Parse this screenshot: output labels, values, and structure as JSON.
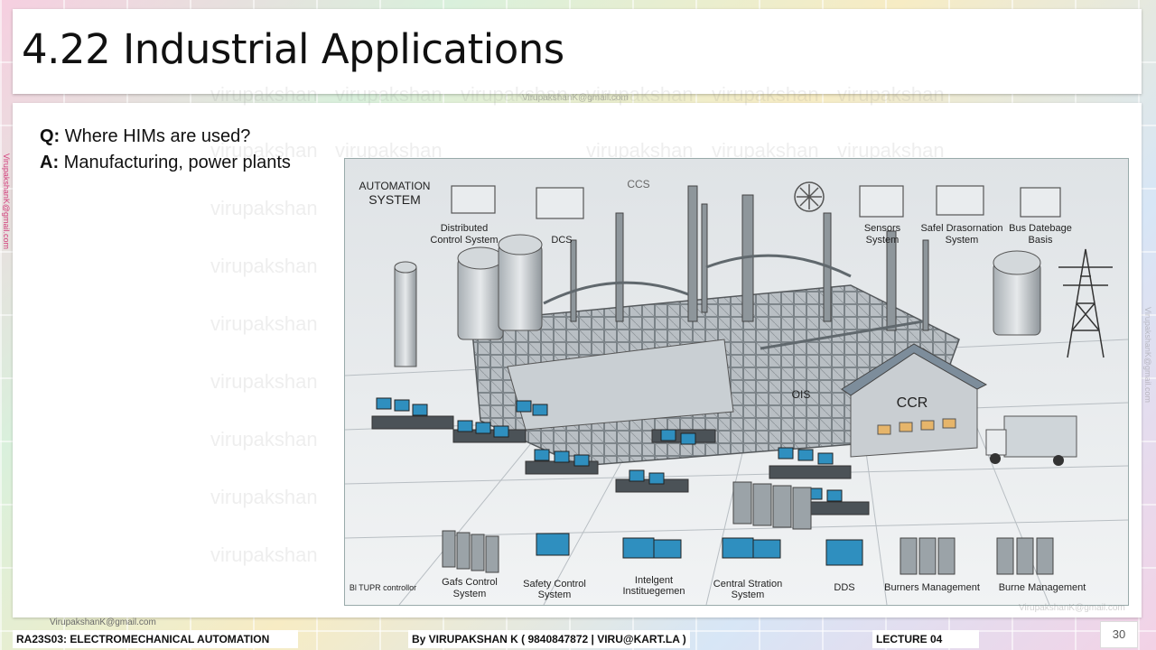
{
  "slide": {
    "title": "4.22 Industrial Applications",
    "question_label": "Q:",
    "question": " Where HIMs are used?",
    "answer_label": "A:",
    "answer": " Manufacturing, power plants",
    "watermark": "virupakshan",
    "email": "VirupakshanK@gmail.com",
    "page_number": "30"
  },
  "figure": {
    "heading": "AUTOMATION SYSTEM",
    "labels": {
      "ccs": "CCS",
      "dcs_left": "Distributed Control System",
      "dcs": "DCS",
      "sensors": "Sensors System",
      "safe": "Safel Drasornation System",
      "bus": "Bus Datebage Basis",
      "ois": "OIS",
      "ccr": "CCR",
      "bl_box": "Bl TUPR controllor",
      "gas": "Gafs Control System",
      "safety": "Safety Control System",
      "intel": "Intelgent Instituegemen",
      "central": "Central Stration System",
      "dds": "DDS",
      "burner1": "Burners Management",
      "burner2": "Burne Management"
    }
  },
  "footer": {
    "course": "RA23S03:   ELECTROMECHANICAL AUTOMATION",
    "author": "By VIRUPAKSHAN K ( 9840847872 | VIRU@KART.LA )",
    "lecture": "LECTURE 04"
  }
}
